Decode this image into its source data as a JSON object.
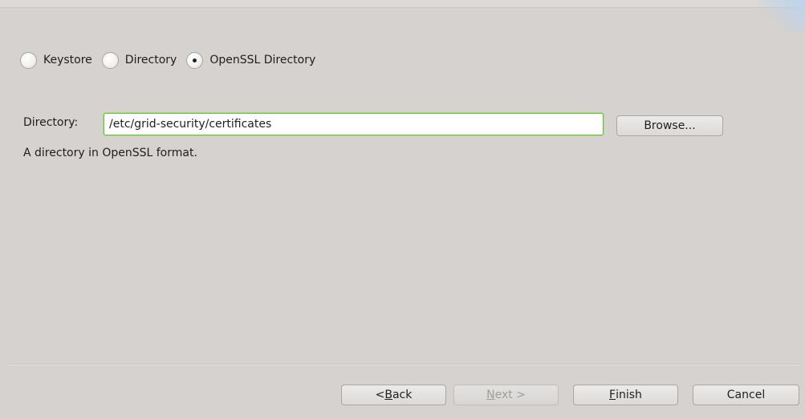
{
  "source_type": {
    "options": [
      {
        "label": "Keystore",
        "checked": false
      },
      {
        "label": "Directory",
        "checked": false
      },
      {
        "label": "OpenSSL Directory",
        "checked": true
      }
    ]
  },
  "directory": {
    "label": "Directory:",
    "value": "/etc/grid-security/certificates",
    "browse_label": "Browse...",
    "help_text": "A directory in OpenSSL format."
  },
  "footer": {
    "back": {
      "mnemonic": "B",
      "prefix": "< ",
      "rest": "ack",
      "enabled": true
    },
    "next": {
      "mnemonic": "N",
      "prefix": "",
      "rest": "ext >",
      "enabled": false
    },
    "finish": {
      "mnemonic": "F",
      "prefix": "",
      "rest": "inish",
      "enabled": true
    },
    "cancel_label": "Cancel"
  }
}
